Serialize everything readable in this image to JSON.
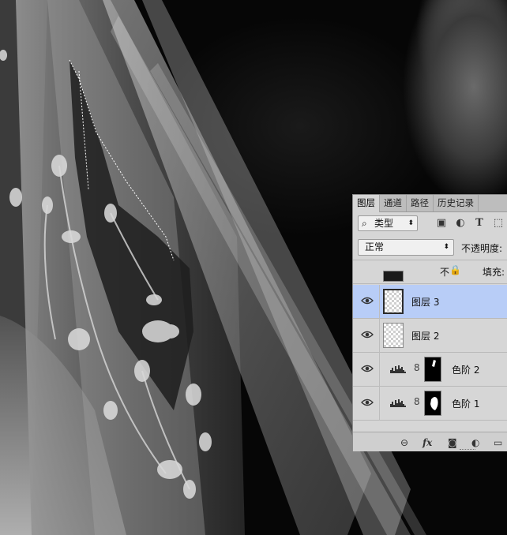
{
  "panel": {
    "tabs": [
      "图层",
      "通道",
      "路径",
      "历史记录"
    ],
    "active_tab": "图层",
    "filter": {
      "icon": "search-icon",
      "label": "类型"
    },
    "filter_icons": [
      "image-filter-icon",
      "adjustment-filter-icon",
      "type-filter-icon",
      "shape-filter-icon"
    ],
    "blend_mode": "正常",
    "opacity_label": "不透明度:",
    "lock_label": "不",
    "fill_label": "填充:",
    "layers": [
      {
        "name": "图层 3",
        "selected": true,
        "visible": true,
        "kind": "pixel"
      },
      {
        "name": "图层 2",
        "selected": false,
        "visible": true,
        "kind": "pixel"
      },
      {
        "name": "色阶 2",
        "selected": false,
        "visible": true,
        "kind": "levels-adjustment"
      },
      {
        "name": "色阶 1",
        "selected": false,
        "visible": true,
        "kind": "levels-adjustment"
      }
    ],
    "footer_icons": [
      "link-icon",
      "fx-icon",
      "add-mask-icon",
      "adjustment-layer-icon",
      "new-group-icon"
    ],
    "fx_label": "fx",
    "colors": {
      "panel_bg": "#d6d6d6",
      "selected_row": "#b8cdf7"
    }
  }
}
